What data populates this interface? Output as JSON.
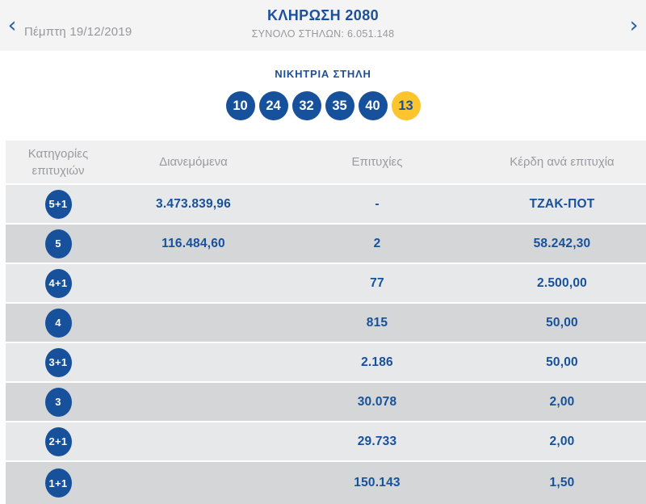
{
  "colors": {
    "navy": "#17519b",
    "ball_yellow": "#fdc52d",
    "gray_text": "#98999c",
    "top_strip_bg": "#f4f4f5",
    "table_header_bg": "#f0f0f1",
    "row_light": "#e7e8ea",
    "row_dark": "#d5d6d8"
  },
  "nav": {
    "prev_icon": "‹",
    "next_icon": "›",
    "date": "Πέμπτη 19/12/2019"
  },
  "draw": {
    "title": "ΚΛΗΡΩΣΗ 2080",
    "total_columns": "ΣΥΝΟΛΟ ΣΤΗΛΩΝ: 6.051.148"
  },
  "winning_column": {
    "title": "ΝΙΚΗΤΡΙΑ ΣΤΗΛΗ",
    "numbers": [
      "10",
      "24",
      "32",
      "35",
      "40"
    ],
    "bonus_number": "13"
  },
  "results_table": {
    "headers": {
      "category": "Κατηγορίες επιτυχιών",
      "distributed": "Διανεμόμενα",
      "winners": "Επιτυχίες",
      "prize": "Κέρδη ανά επιτυχία"
    },
    "rows": [
      {
        "category": "5+1",
        "distributed": "3.473.839,96",
        "winners": "-",
        "prize": "ΤΖΑΚ-ΠΟΤ"
      },
      {
        "category": "5",
        "distributed": "116.484,60",
        "winners": "2",
        "prize": "58.242,30"
      },
      {
        "category": "4+1",
        "distributed": "",
        "winners": "77",
        "prize": "2.500,00"
      },
      {
        "category": "4",
        "distributed": "",
        "winners": "815",
        "prize": "50,00"
      },
      {
        "category": "3+1",
        "distributed": "",
        "winners": "2.186",
        "prize": "50,00"
      },
      {
        "category": "3",
        "distributed": "",
        "winners": "30.078",
        "prize": "2,00"
      },
      {
        "category": "2+1",
        "distributed": "",
        "winners": "29.733",
        "prize": "2,00"
      },
      {
        "category": "1+1",
        "distributed": "",
        "winners": "150.143",
        "prize": "1,50"
      }
    ]
  }
}
